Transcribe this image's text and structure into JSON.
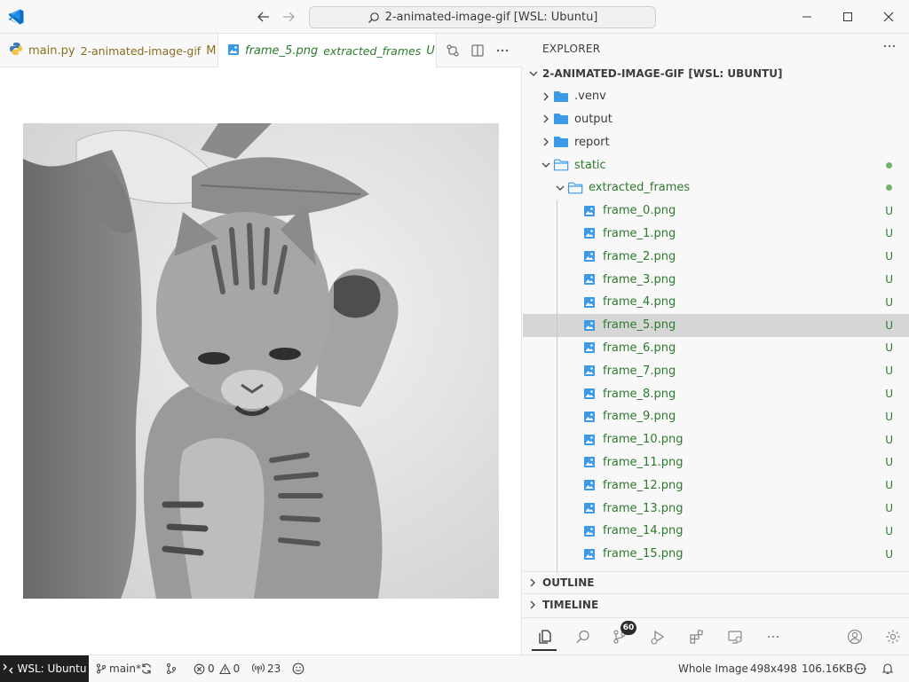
{
  "titlebar": {
    "search_text": "2-animated-image-gif [WSL: Ubuntu]"
  },
  "tabs": [
    {
      "name": "main.py",
      "description": "2-animated-image-gif",
      "status": "M"
    },
    {
      "name": "frame_5.png",
      "description": "extracted_frames",
      "status": "U"
    }
  ],
  "explorer": {
    "title": "EXPLORER",
    "root": "2-ANIMATED-IMAGE-GIF [WSL: UBUNTU]",
    "folders": [
      {
        "label": ".venv"
      },
      {
        "label": "output"
      },
      {
        "label": "report"
      }
    ],
    "static_folder": "static",
    "extracted_folder": "extracted_frames",
    "files": [
      {
        "label": "frame_0.png",
        "status": "U"
      },
      {
        "label": "frame_1.png",
        "status": "U"
      },
      {
        "label": "frame_2.png",
        "status": "U"
      },
      {
        "label": "frame_3.png",
        "status": "U"
      },
      {
        "label": "frame_4.png",
        "status": "U"
      },
      {
        "label": "frame_5.png",
        "status": "U"
      },
      {
        "label": "frame_6.png",
        "status": "U"
      },
      {
        "label": "frame_7.png",
        "status": "U"
      },
      {
        "label": "frame_8.png",
        "status": "U"
      },
      {
        "label": "frame_9.png",
        "status": "U"
      },
      {
        "label": "frame_10.png",
        "status": "U"
      },
      {
        "label": "frame_11.png",
        "status": "U"
      },
      {
        "label": "frame_12.png",
        "status": "U"
      },
      {
        "label": "frame_13.png",
        "status": "U"
      },
      {
        "label": "frame_14.png",
        "status": "U"
      },
      {
        "label": "frame_15.png",
        "status": "U"
      }
    ],
    "outline": "OUTLINE",
    "timeline": "TIMELINE"
  },
  "activity": {
    "scm_badge": "60"
  },
  "statusbar": {
    "remote": "WSL: Ubuntu",
    "branch": "main*",
    "errors": "0",
    "warnings": "0",
    "ports": "23",
    "zoom": "Whole Image",
    "dimensions": "498x498",
    "filesize": "106.16KB"
  },
  "colors": {
    "accent": "#0078d4",
    "untracked_green": "#2d7a2d",
    "folder_blue": "#3b99e6"
  }
}
